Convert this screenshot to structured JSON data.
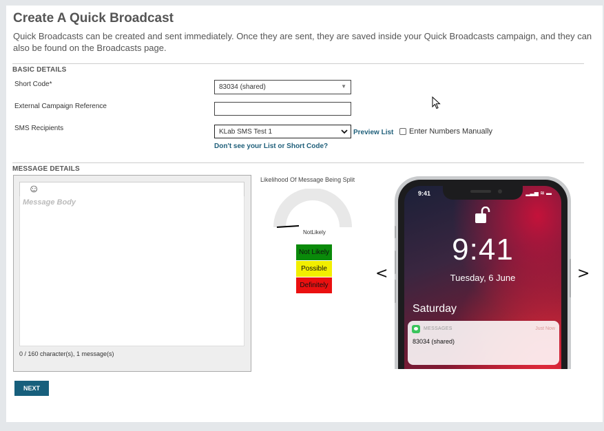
{
  "page": {
    "title": "Create A Quick Broadcast",
    "description": "Quick Broadcasts can be created and sent immediately. Once they are sent, they are saved inside your Quick Broadcasts campaign, and they can also be found on the Broadcasts page."
  },
  "basic_details": {
    "heading": "BASIC DETAILS",
    "short_code": {
      "label": "Short Code*",
      "value": "83034 (shared)"
    },
    "external_ref": {
      "label": "External Campaign Reference",
      "value": ""
    },
    "sms_recipients": {
      "label": "SMS Recipients",
      "value": "KLab SMS Test 1",
      "preview_link": "Preview List",
      "manual_checkbox_label": "Enter Numbers Manually",
      "manual_checked": false
    },
    "help_link": "Don't see your List or Short Code?"
  },
  "message_details": {
    "heading": "MESSAGE DETAILS",
    "emoji_icon": "smiley-icon",
    "body_placeholder": "Message Body",
    "char_count": "0 / 160 character(s), 1 message(s)"
  },
  "split_meter": {
    "title": "Likelihood Of Message Being Split",
    "current_label": "NotLikely",
    "level_fraction": 0.0,
    "legend": [
      {
        "label": "Not Likely",
        "color": "#0a8a0a"
      },
      {
        "label": "Possible",
        "color": "#f2ee00"
      },
      {
        "label": "Definitely",
        "color": "#ea1010"
      }
    ]
  },
  "preview": {
    "prev_arrow": "<",
    "next_arrow": ">",
    "status_time": "9:41",
    "status_icons": "▂▃▅ ≋ ▬",
    "lock_icon": "unlock-icon",
    "lock_time": "9:41",
    "lock_date": "Tuesday, 6 June",
    "day": "Saturday",
    "notification": {
      "app": "MESSAGES",
      "time": "Just Now",
      "body": "83034 (shared)"
    }
  },
  "actions": {
    "next_label": "NEXT"
  }
}
